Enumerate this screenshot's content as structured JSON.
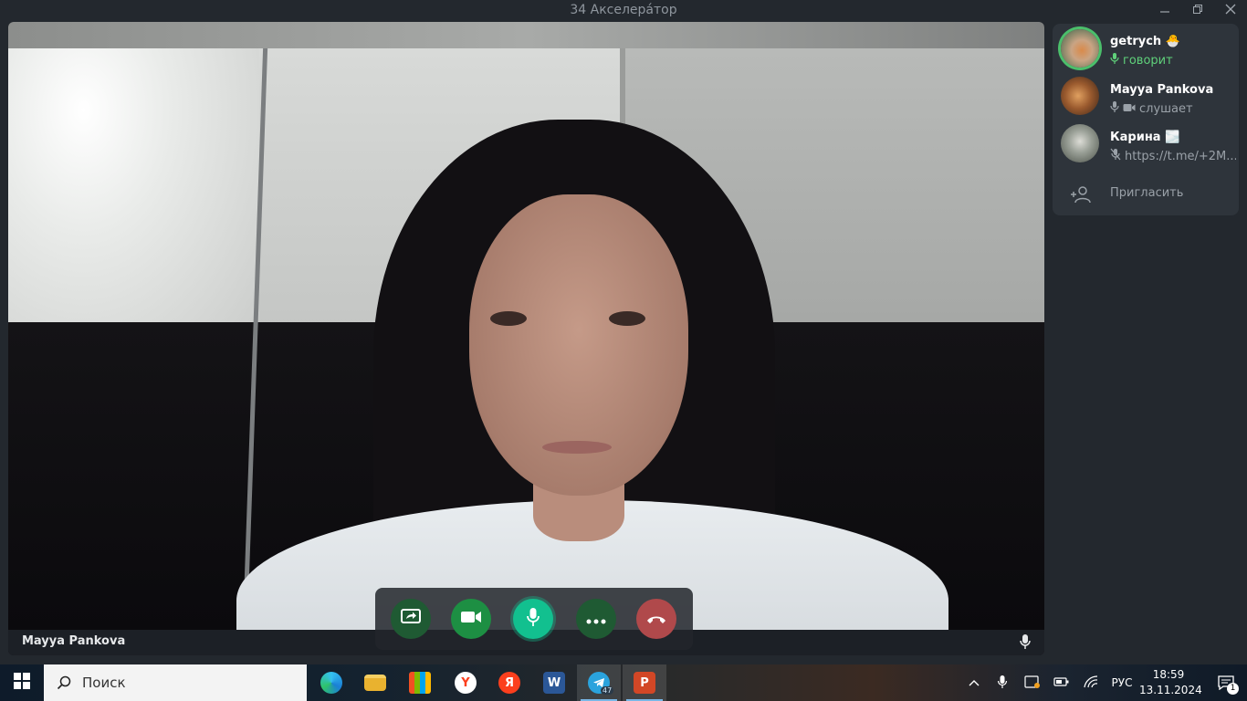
{
  "window": {
    "title": "34 Акселерáтор",
    "minimize_icon": "minimize-icon",
    "maximize_icon": "restore-icon",
    "close_icon": "close-icon"
  },
  "video": {
    "speaker_name": "Mayya Pankova",
    "mic_icon": "microphone-icon"
  },
  "controls": [
    {
      "name": "screen-share-button",
      "icon": "screen-share-icon",
      "color": "#1f5a33"
    },
    {
      "name": "camera-button",
      "icon": "video-camera-icon",
      "color": "#1d8f43"
    },
    {
      "name": "microphone-button",
      "icon": "microphone-icon",
      "color": "#12c08f"
    },
    {
      "name": "more-button",
      "icon": "more-dots-icon",
      "color": "#1f5a33"
    },
    {
      "name": "leave-call-button",
      "icon": "hang-up-icon",
      "color": "#b0494b"
    }
  ],
  "participants": [
    {
      "name": "getrych",
      "emoji": "🐣",
      "status": "говорит",
      "status_color": "#5fd07a",
      "speaking": true
    },
    {
      "name": "Mayya Pankova",
      "emoji": "",
      "status": "слушает",
      "status_color": "#9aa1a8",
      "speaking": false
    },
    {
      "name": "Карина",
      "emoji": "🌫️",
      "status": "https://t.me/+2M...",
      "status_color": "#9aa1a8",
      "speaking": false
    }
  ],
  "invite": {
    "label": "Пригласить",
    "icon": "add-person-icon"
  },
  "taskbar": {
    "search_placeholder": "Поиск",
    "apps": [
      {
        "name": "edge",
        "icon": "edge-icon",
        "color": "#1a7fd6",
        "label": "e"
      },
      {
        "name": "explorer",
        "icon": "folder-icon",
        "color": "#e9b22f",
        "label": ""
      },
      {
        "name": "store",
        "icon": "store-icon",
        "color": "#2d6fd0",
        "label": ""
      },
      {
        "name": "yandex-browser",
        "icon": "yandex-browser-icon",
        "color": "#f0f0f0",
        "label": "Y"
      },
      {
        "name": "yandex",
        "icon": "yandex-icon",
        "color": "#fc3f1d",
        "label": "Я"
      },
      {
        "name": "word",
        "icon": "word-icon",
        "color": "#2b5797",
        "label": "W"
      },
      {
        "name": "telegram",
        "icon": "telegram-icon",
        "color": "#2aa3dd",
        "label": "",
        "badge": "47"
      },
      {
        "name": "powerpoint",
        "icon": "powerpoint-icon",
        "color": "#d24726",
        "label": "P"
      }
    ],
    "language": "РУС",
    "time": "18:59",
    "date": "13.11.2024",
    "notification_count": "1"
  }
}
